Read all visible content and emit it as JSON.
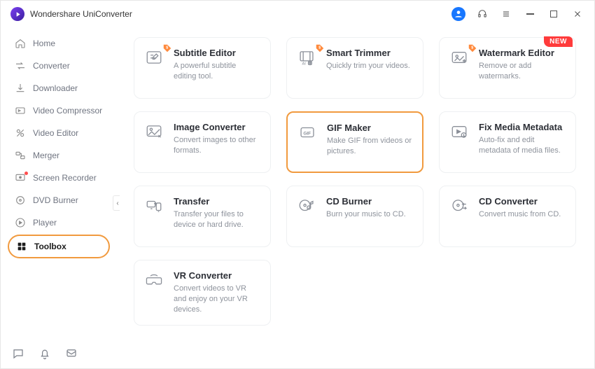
{
  "app": {
    "title": "Wondershare UniConverter"
  },
  "sidebar": {
    "items": [
      {
        "label": "Home",
        "icon": "home-icon"
      },
      {
        "label": "Converter",
        "icon": "converter-icon"
      },
      {
        "label": "Downloader",
        "icon": "downloader-icon"
      },
      {
        "label": "Video Compressor",
        "icon": "compressor-icon"
      },
      {
        "label": "Video Editor",
        "icon": "editor-icon"
      },
      {
        "label": "Merger",
        "icon": "merger-icon"
      },
      {
        "label": "Screen Recorder",
        "icon": "recorder-icon"
      },
      {
        "label": "DVD Burner",
        "icon": "dvd-icon"
      },
      {
        "label": "Player",
        "icon": "player-icon"
      },
      {
        "label": "Toolbox",
        "icon": "toolbox-icon"
      }
    ],
    "activeIndex": 9,
    "redDotIndex": 6
  },
  "badges": {
    "new": "NEW"
  },
  "tools": [
    {
      "title": "Subtitle Editor",
      "desc": "A powerful subtitle editing tool.",
      "icon": "subtitle-icon",
      "price": true
    },
    {
      "title": "Smart Trimmer",
      "desc": "Quickly trim your videos.",
      "icon": "trimmer-icon",
      "price": true
    },
    {
      "title": "Watermark Editor",
      "desc": "Remove or add watermarks.",
      "icon": "watermark-icon",
      "price": true,
      "new": true
    },
    {
      "title": "Image Converter",
      "desc": "Convert images to other formats.",
      "icon": "image-icon"
    },
    {
      "title": "GIF Maker",
      "desc": "Make GIF from videos or pictures.",
      "icon": "gif-icon",
      "highlight": true
    },
    {
      "title": "Fix Media Metadata",
      "desc": "Auto-fix and edit metadata of media files.",
      "icon": "metadata-icon"
    },
    {
      "title": "Transfer",
      "desc": "Transfer your files to device or hard drive.",
      "icon": "transfer-icon"
    },
    {
      "title": "CD Burner",
      "desc": "Burn your music to CD.",
      "icon": "cdburner-icon"
    },
    {
      "title": "CD Converter",
      "desc": "Convert music from CD.",
      "icon": "cdconverter-icon"
    },
    {
      "title": "VR Converter",
      "desc": "Convert videos to VR and enjoy on your VR devices.",
      "icon": "vr-icon"
    }
  ]
}
